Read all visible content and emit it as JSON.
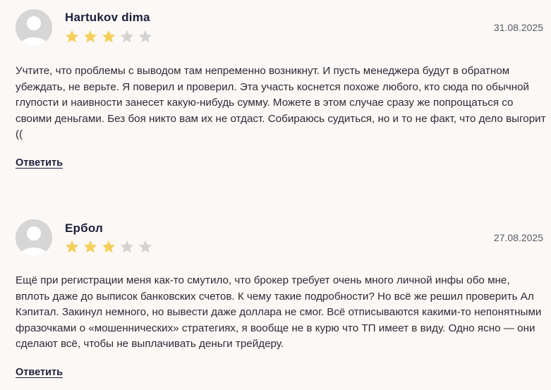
{
  "reviews": [
    {
      "author": "Hartukov dima",
      "date": "31.08.2025",
      "rating": 3,
      "max_rating": 5,
      "text": "Учтите, что проблемы с выводом там непременно возникнут. И пусть менеджера будут в обратном убеждать, не верьте. Я поверил и проверил. Эта участь коснется похоже любого, кто сюда по обычной глупости и наивности занесет какую-нибудь сумму. Можете в этом случае сразу же попрощаться со своими деньгами. Без боя никто вам их не отдаст. Собираюсь судиться, но и то не факт, что дело выгорит ((",
      "reply_label": "Ответить"
    },
    {
      "author": "Ербол",
      "date": "27.08.2025",
      "rating": 3,
      "max_rating": 5,
      "text": "Ещё при регистрации меня как-то смутило, что брокер требует очень много личной инфы обо мне, вплоть даже до выписок банковских счетов. К чему такие подробности? Но всё же решил проверить Ал Кэпитал. Закинул немного, но вывести даже доллара не смог. Всё отписываются какими-то непонятными фразочками о «мошеннических» стратегиях, я вообще не в курю что ТП имеет в виду. Одно ясно — они сделают всё, чтобы не выплачивать деньги трейдеру.",
      "reply_label": "Ответить"
    }
  ],
  "colors": {
    "star_filled": "#f5cf5b",
    "star_empty": "#d3d3d3",
    "avatar_bg": "#d6d6d6",
    "avatar_fg": "#ffffff"
  },
  "icons": {
    "avatar": "user-avatar-icon",
    "star": "star-icon"
  }
}
